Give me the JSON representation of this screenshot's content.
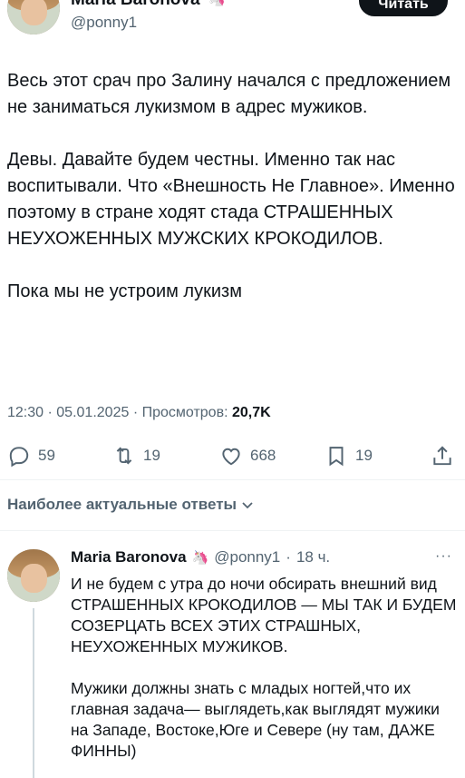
{
  "author": {
    "name": "Maria Baronova",
    "emoji": "🦄",
    "handle": "@ponny1"
  },
  "header": {
    "read_button_label": "Читать"
  },
  "tweet": {
    "paragraphs": [
      "Весь этот срач про Залину начался с предложением не заниматься лукизмом в адрес мужиков.",
      "Девы. Давайте будем честны. Именно так нас воспитывали. Что «Внешность Не Главное». Именно поэтому в стране ходят стада СТРАШЕННЫХ НЕУХОЖЕННЫХ МУЖСКИХ КРОКОДИЛОВ.",
      "Пока мы не устроим лукизм"
    ],
    "time": "12:30",
    "date": "05.01.2025",
    "views_label": "Просмотров:",
    "views_value": "20,7K",
    "separator": "·"
  },
  "actions": {
    "replies": "59",
    "reposts": "19",
    "likes": "668",
    "bookmarks": "19",
    "icons": [
      "reply-icon",
      "repost-icon",
      "like-icon",
      "bookmark-icon",
      "share-icon"
    ]
  },
  "sort": {
    "label": "Наиболее актуальные ответы"
  },
  "reply": {
    "name": "Maria Baronova",
    "emoji": "🦄",
    "handle": "@ponny1",
    "age": "18 ч.",
    "more": "···",
    "paragraphs": [
      "И не будем с утра до ночи обсирать внешний вид СТРАШЕННЫХ КРОКОДИЛОВ — МЫ ТАК И БУДЕМ СОЗЕРЦАТЬ ВСЕХ ЭТИХ СТРАШНЫХ, НЕУХОЖЕННЫХ МУЖИКОВ.",
      "Мужики должны знать с младых ногтей,что их главная задача— выглядеть,как выглядят мужики на Западе, Востоке,Юге и Севере (ну там, ДАЖЕ ФИННЫ)"
    ]
  },
  "colors": {
    "text": "#0f1419",
    "secondary": "#536471",
    "divider": "#eff3f4",
    "button_bg": "#0f1419"
  }
}
